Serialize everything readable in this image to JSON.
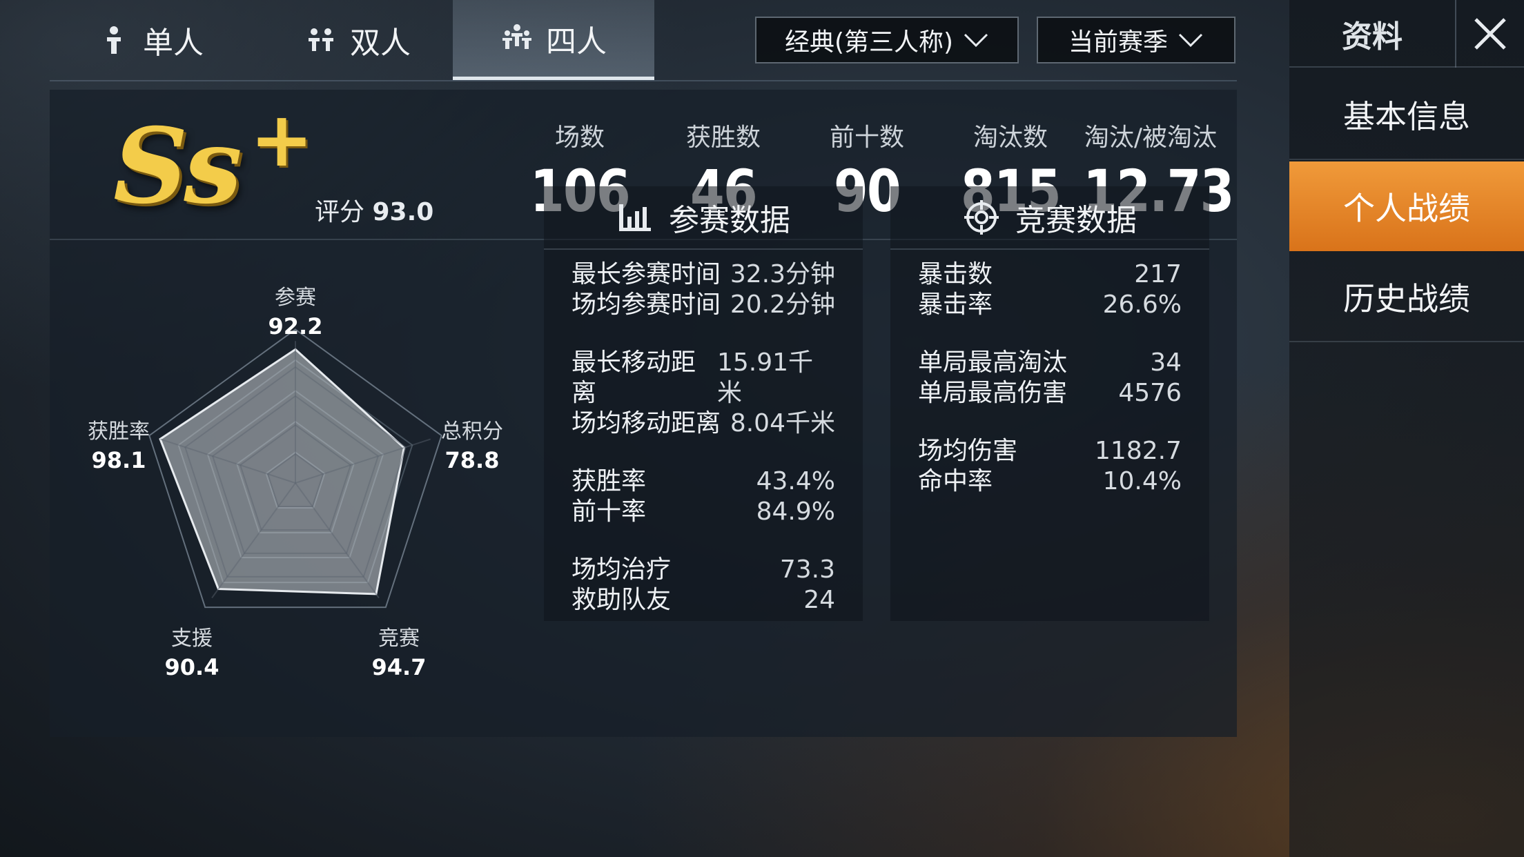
{
  "tabs": [
    {
      "label": "单人",
      "icon": "single-player-icon",
      "active": false
    },
    {
      "label": "双人",
      "icon": "duo-players-icon",
      "active": false
    },
    {
      "label": "四人",
      "icon": "squad-players-icon",
      "active": true
    }
  ],
  "dropdowns": {
    "mode": "经典(第三人称)",
    "season": "当前赛季"
  },
  "sidebar": {
    "title": "资料",
    "close_icon": "close-icon",
    "items": [
      {
        "label": "基本信息",
        "active": false
      },
      {
        "label": "个人战绩",
        "active": true
      },
      {
        "label": "历史战绩",
        "active": false
      }
    ]
  },
  "summary": {
    "rank_main": "Ss",
    "rank_plus": "+",
    "score_label": "评分",
    "score_value": "93.0",
    "stats": [
      {
        "label": "场数",
        "value": "106"
      },
      {
        "label": "获胜数",
        "value": "46"
      },
      {
        "label": "前十数",
        "value": "90"
      },
      {
        "label": "淘汰数",
        "value": "815"
      },
      {
        "label": "淘汰/被淘汰",
        "value": "12.73"
      }
    ]
  },
  "radar": {
    "axes": [
      {
        "label": "参赛",
        "value": "92.2",
        "score": 92.2
      },
      {
        "label": "总积分",
        "value": "78.8",
        "score": 78.8
      },
      {
        "label": "竞赛",
        "value": "94.7",
        "score": 94.7
      },
      {
        "label": "支援",
        "value": "90.4",
        "score": 90.4
      },
      {
        "label": "获胜率",
        "value": "98.1",
        "score": 98.1
      }
    ]
  },
  "participation": {
    "title": "参赛数据",
    "icon": "bar-chart-icon",
    "groups": [
      [
        {
          "k": "最长参赛时间",
          "v": "32.3分钟"
        },
        {
          "k": "场均参赛时间",
          "v": "20.2分钟"
        }
      ],
      [
        {
          "k": "最长移动距离",
          "v": "15.91千米"
        },
        {
          "k": "场均移动距离",
          "v": "8.04千米"
        }
      ],
      [
        {
          "k": "获胜率",
          "v": "43.4%"
        },
        {
          "k": "前十率",
          "v": "84.9%"
        }
      ],
      [
        {
          "k": "场均治疗",
          "v": "73.3"
        },
        {
          "k": "救助队友",
          "v": "24"
        }
      ]
    ]
  },
  "competition": {
    "title": "竞赛数据",
    "icon": "crosshair-icon",
    "groups": [
      [
        {
          "k": "暴击数",
          "v": "217"
        },
        {
          "k": "暴击率",
          "v": "26.6%"
        }
      ],
      [
        {
          "k": "单局最高淘汰",
          "v": "34"
        },
        {
          "k": "单局最高伤害",
          "v": "4576"
        }
      ],
      [
        {
          "k": "场均伤害",
          "v": "1182.7"
        },
        {
          "k": "命中率",
          "v": "10.4%"
        }
      ]
    ]
  },
  "colors": {
    "accent_orange": "#e88428",
    "rank_gold": "#f3cc4a"
  }
}
